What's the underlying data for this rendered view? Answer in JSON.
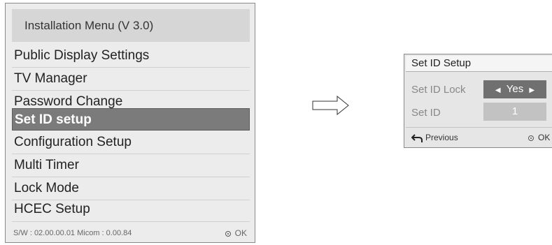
{
  "menu": {
    "title": "Installation Menu (V 3.0)",
    "items": [
      {
        "label": "Public Display Settings",
        "selected": false
      },
      {
        "label": "TV Manager",
        "selected": false
      },
      {
        "label": "Password Change",
        "selected": false
      },
      {
        "label": "Set ID setup",
        "selected": true
      },
      {
        "label": "Configuration Setup",
        "selected": false
      },
      {
        "label": "Multi Timer",
        "selected": false
      },
      {
        "label": "Lock Mode",
        "selected": false
      },
      {
        "label": "HCEC Setup",
        "selected": false
      }
    ],
    "footer_sw": "S/W : 02.00.00.01 Micom : 0.00.84",
    "footer_ok": "OK"
  },
  "arrow_icon": "right-arrow-icon",
  "popup": {
    "title": "Set ID Setup",
    "rows": [
      {
        "label": "Set ID Lock",
        "value": "Yes",
        "arrows": true
      },
      {
        "label": "Set ID",
        "value": "1",
        "arrows": false
      }
    ],
    "previous_label": "Previous",
    "ok_label": "OK"
  },
  "colors": {
    "selected_bg": "#7b7b7b",
    "menu_bg": "#ececec",
    "title_bg": "#d6d6d6"
  }
}
